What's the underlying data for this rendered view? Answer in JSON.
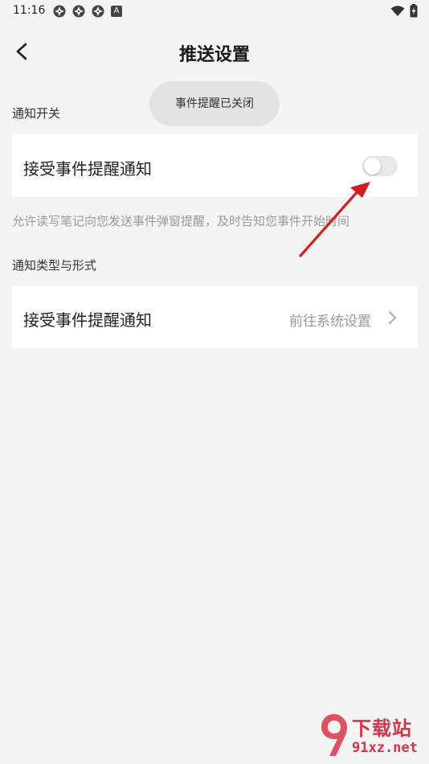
{
  "status_bar": {
    "time": "11:16",
    "icons": [
      "app-icon",
      "app-icon",
      "app-icon",
      "a-icon"
    ],
    "a_icon_letter": "A",
    "right_icons": [
      "wifi-icon",
      "battery-charging-icon"
    ]
  },
  "header": {
    "title": "推送设置",
    "back_icon": "back-arrow-icon"
  },
  "toast": {
    "text": "事件提醒已关闭"
  },
  "section1": {
    "label": "通知开关",
    "row_label": "接受事件提醒通知",
    "toggle_on": false,
    "hint": "允许读写笔记向您发送事件弹窗提醒，及时告知您事件开始时间"
  },
  "section2": {
    "label": "通知类型与形式",
    "row_label": "接受事件提醒通知",
    "row_value": "前往系统设置",
    "chevron_icon": "chevron-right-icon"
  },
  "watermark": {
    "line1": "下载站",
    "line2": "91xz.net"
  },
  "colors": {
    "background": "#f4f4f4",
    "card": "#ffffff",
    "toast": "#e3e3e3",
    "arrow": "#d21e1e",
    "watermark": "#d9334a"
  }
}
